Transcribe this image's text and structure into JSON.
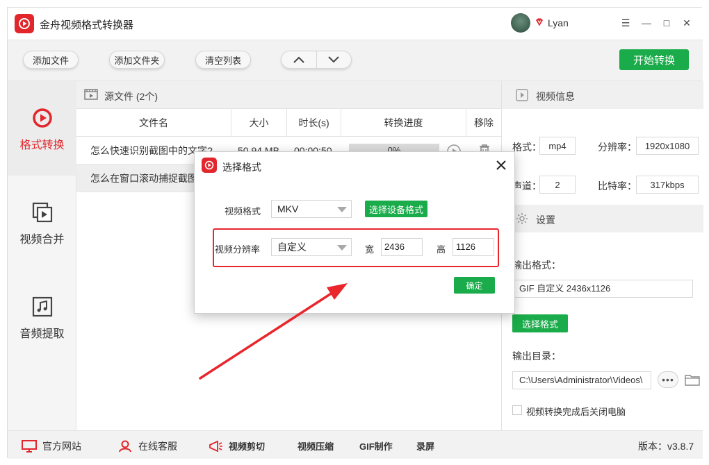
{
  "app": {
    "title": "金舟视频格式转换器",
    "user_name": "Lyan"
  },
  "window_controls": {
    "menu": "☰",
    "minimize": "—",
    "maximize": "□",
    "close": "✕"
  },
  "toolbar": {
    "add_file": "添加文件",
    "add_folder": "添加文件夹",
    "clear_list": "清空列表",
    "start_convert": "开始转换"
  },
  "sidebar": {
    "items": [
      {
        "label": "格式转换",
        "icon": "play-circle-icon",
        "active": true
      },
      {
        "label": "视频合并",
        "icon": "video-merge-icon",
        "active": false
      },
      {
        "label": "音频提取",
        "icon": "music-note-icon",
        "active": false
      }
    ]
  },
  "file_list": {
    "header": "源文件 (2个)",
    "columns": [
      "文件名",
      "大小",
      "时长(s)",
      "转换进度",
      "移除"
    ],
    "rows": [
      {
        "name": "怎么快速识别截图中的文字?",
        "size": "50.94 MB",
        "duration": "00:00:50",
        "progress": "0%"
      },
      {
        "name": "怎么在窗口滚动捕捉截图",
        "size": "",
        "duration": "",
        "progress": ""
      }
    ]
  },
  "video_info": {
    "header": "视频信息",
    "format_label": "格式：",
    "format_value": "mp4",
    "resolution_label": "分辨率：",
    "resolution_value": "1920x1080",
    "channel_label": "声道：",
    "channel_value": "2",
    "bitrate_label": "比特率：",
    "bitrate_value": "317kbps"
  },
  "settings": {
    "header": "设置",
    "output_format_label": "输出格式：",
    "output_format_value": "GIF 自定义 2436x1126",
    "choose_format": "选择格式",
    "output_dir_label": "输出目录：",
    "output_dir_value": "C:\\Users\\Administrator\\Videos\\",
    "dots": "•••",
    "shutdown_label": "视频转换完成后关闭电脑"
  },
  "footer": {
    "website": "官方网站",
    "support": "在线客服",
    "video_cut": "视频剪切",
    "video_compress": "视频压缩",
    "gif_make": "GIF制作",
    "record": "录屏",
    "version": "版本：v3.8.7"
  },
  "dialog": {
    "title": "选择格式",
    "video_format_label": "视频格式",
    "video_format_value": "MKV",
    "device_format_button": "选择设备格式",
    "resolution_label": "视频分辨率",
    "resolution_value": "自定义",
    "width_label": "宽",
    "width_value": "2436",
    "height_label": "高",
    "height_value": "1126",
    "confirm": "确定"
  },
  "colors": {
    "brand_red": "#e1262c",
    "accent_green": "#1aab4a",
    "annotation_red": "#e8262c"
  }
}
